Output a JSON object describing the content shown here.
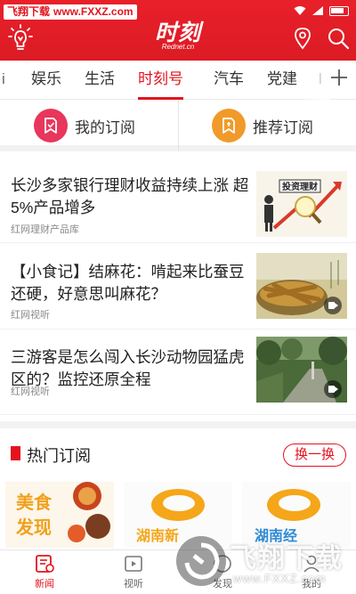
{
  "watermark_top": {
    "brand": "飞翔下载",
    "url": "www.FXXZ.com"
  },
  "header": {
    "logo": "时刻",
    "logo_sub": "Rednet.cn"
  },
  "tabs": [
    {
      "label": "i"
    },
    {
      "label": "娱乐"
    },
    {
      "label": "生活"
    },
    {
      "label": "时刻号",
      "active": true
    },
    {
      "label": "汽车"
    },
    {
      "label": "党建"
    },
    {
      "label": "l"
    }
  ],
  "subscriptions": {
    "mine": "我的订阅",
    "recommended": "推荐订阅"
  },
  "news": [
    {
      "title": "长沙多家银行理财收益持续上涨 超5%产品增多",
      "source": "红网理财产品库",
      "thumb_text": "投资理财"
    },
    {
      "title": "【小食记】结麻花：啃起来比蚕豆还硬，好意思叫麻花？",
      "source": "红网视听"
    },
    {
      "title": "三游客是怎么闯入长沙动物园猛虎区的？监控还原全程",
      "source": "红网视听"
    }
  ],
  "hot": {
    "title": "热门订阅",
    "swap": "换一换",
    "cards": [
      {
        "text_line1": "美食",
        "text_line2": "发现"
      },
      {
        "text_line1": "湖南新"
      },
      {
        "text_line1": "湖南经"
      }
    ]
  },
  "bottom_nav": [
    {
      "label": "新闻",
      "active": true
    },
    {
      "label": "视听"
    },
    {
      "label": "发现"
    },
    {
      "label": "我的"
    }
  ],
  "watermark_bottom": {
    "name": "飞翔下载",
    "url": "www.FXXZ.com"
  },
  "colors": {
    "brand_red": "#e3141e",
    "sub_mine": "#e8365c",
    "sub_recommended": "#f19a2a"
  }
}
